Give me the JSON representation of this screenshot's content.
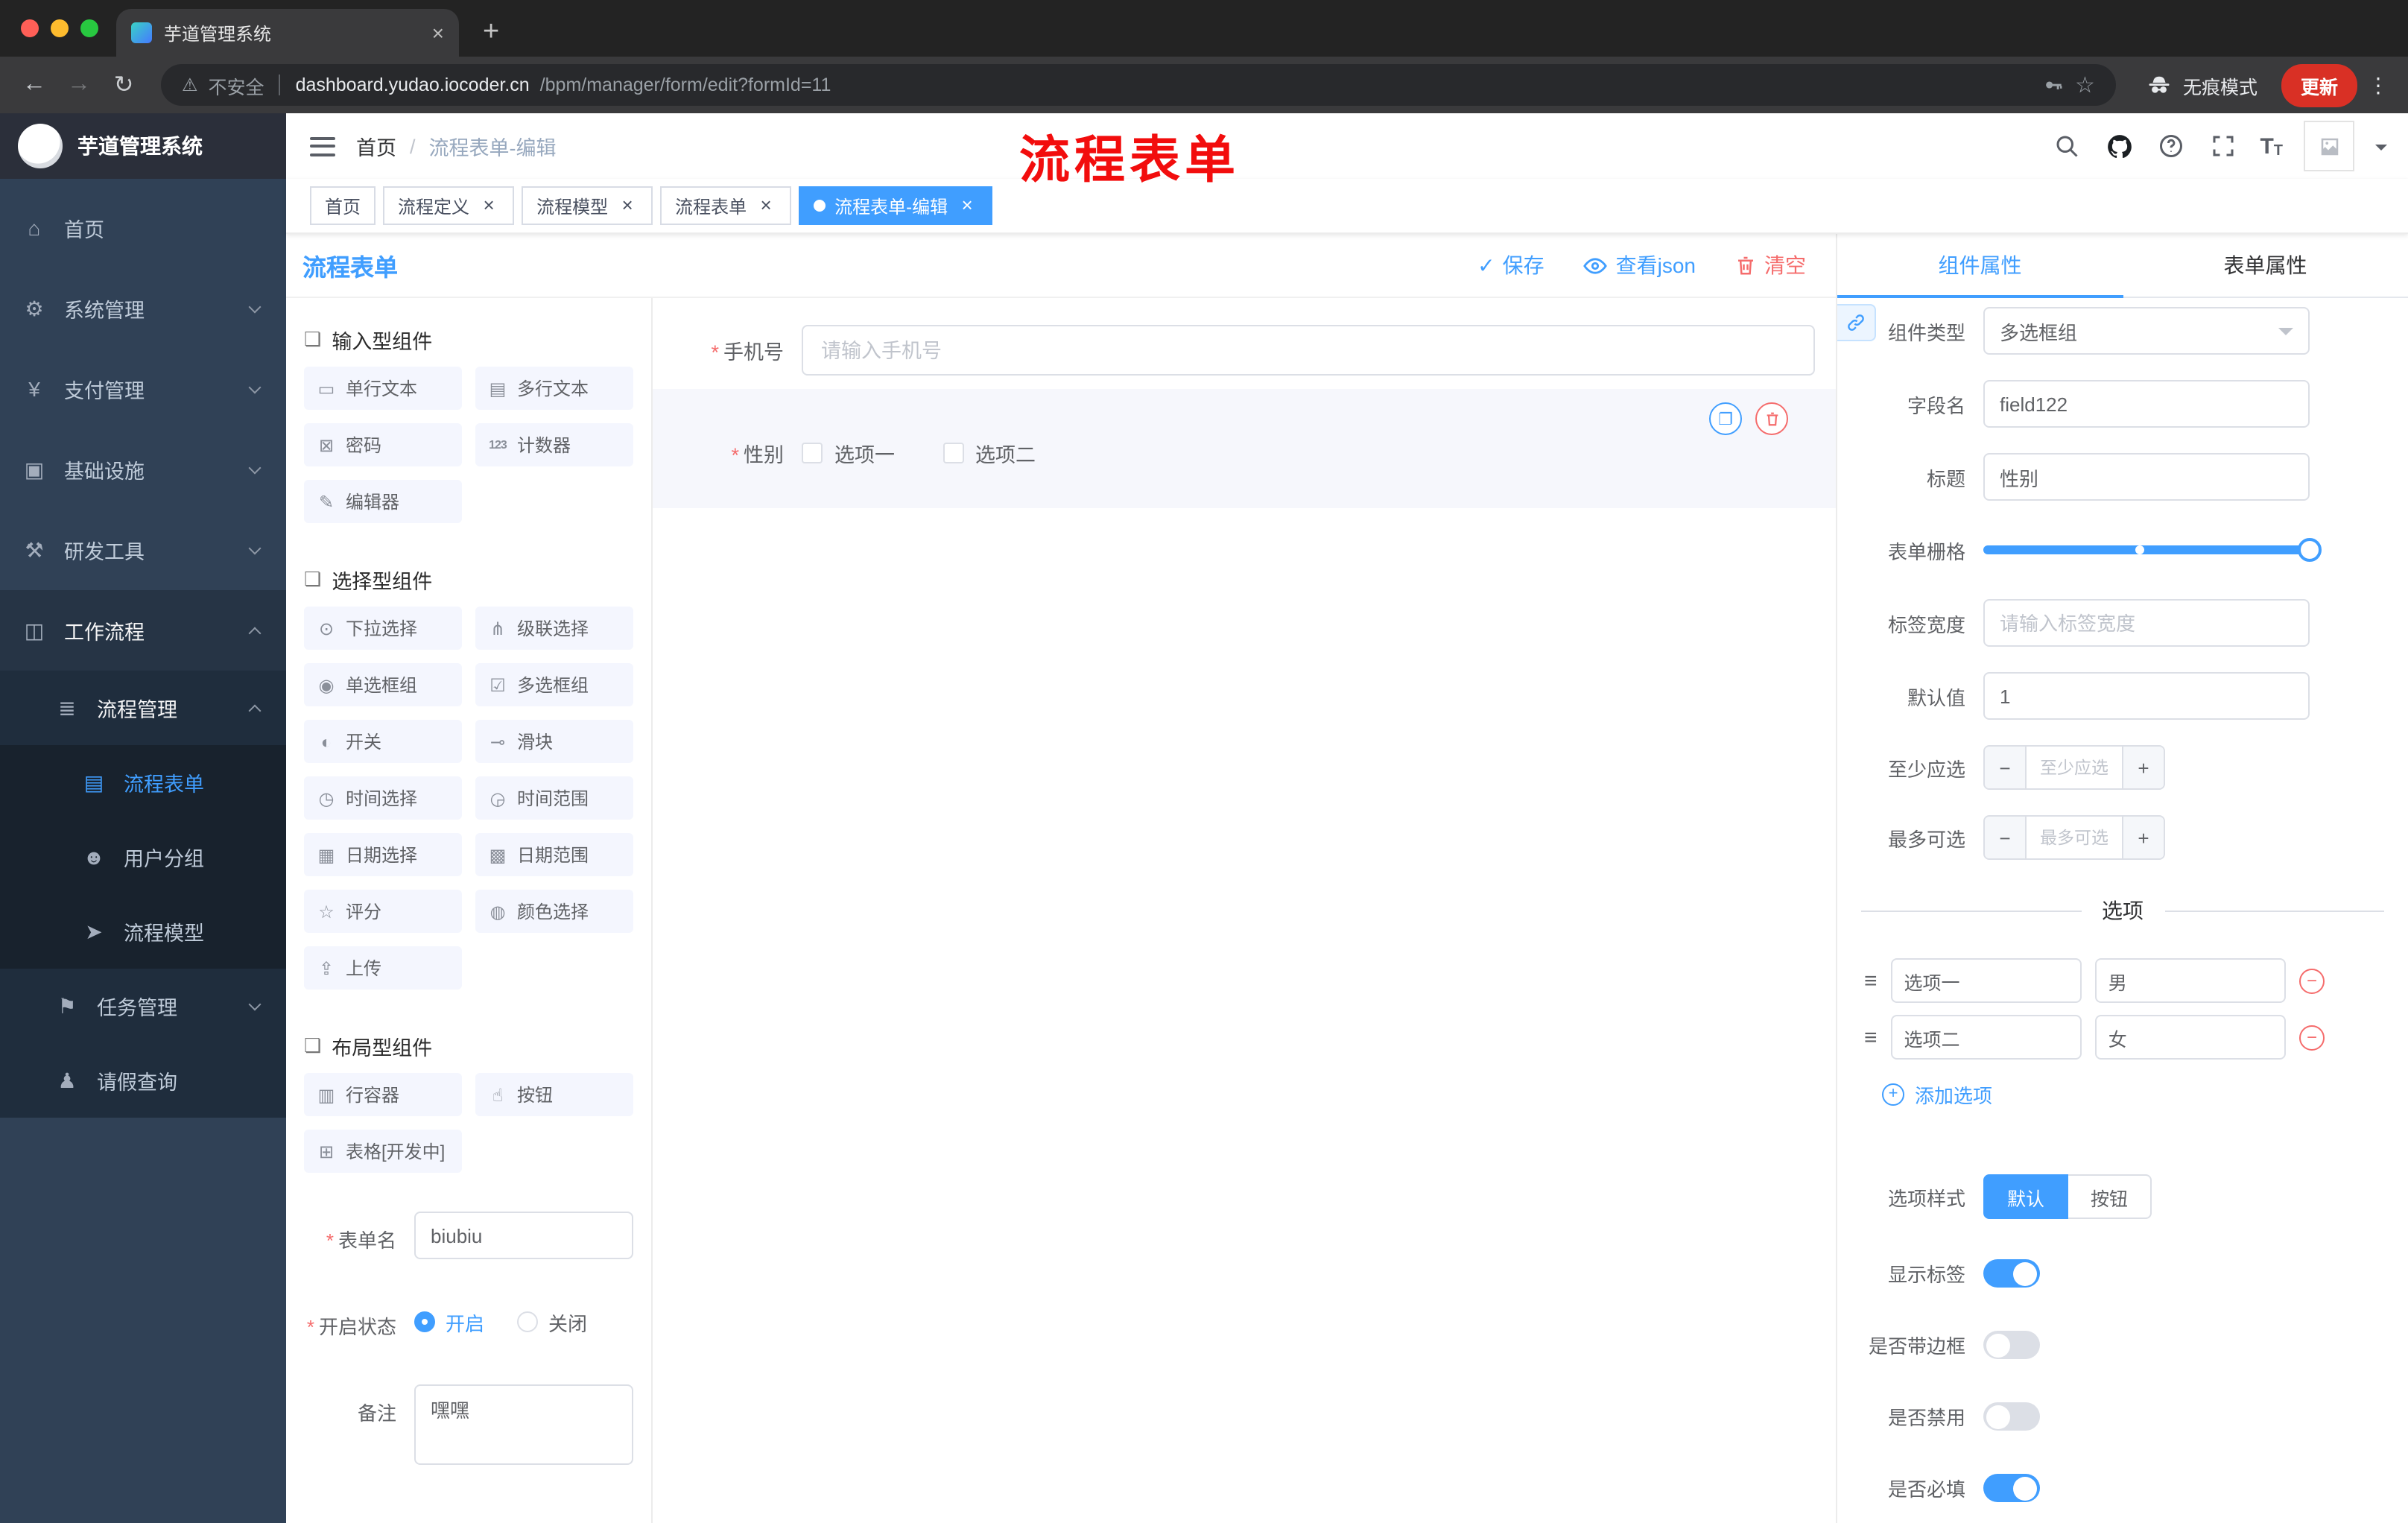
{
  "colors": {
    "accent": "#409eff",
    "danger": "#f56c6c",
    "annotation": "#f20d0d",
    "sidebar_bg": "#304156",
    "active_tag": "#409eff"
  },
  "browser": {
    "tab_title": "芋道管理系统",
    "security": "不安全",
    "domain": "dashboard.yudao.iocoder.cn",
    "path": "/bpm/manager/form/edit?formId=11",
    "incognito": "无痕模式",
    "update": "更新"
  },
  "sidebar": {
    "title": "芋道管理系统",
    "menu": [
      {
        "key": "home",
        "label": "首页",
        "glyph": "⌂",
        "level": 1
      },
      {
        "key": "system",
        "label": "系统管理",
        "glyph": "⚙",
        "level": 1,
        "chevron": "down"
      },
      {
        "key": "payment",
        "label": "支付管理",
        "glyph": "¥",
        "level": 1,
        "chevron": "down"
      },
      {
        "key": "infra",
        "label": "基础设施",
        "glyph": "▣",
        "level": 1,
        "chevron": "down"
      },
      {
        "key": "devtools",
        "label": "研发工具",
        "glyph": "⚒",
        "level": 1,
        "chevron": "down"
      },
      {
        "key": "workflow",
        "label": "工作流程",
        "glyph": "◫",
        "level": 1,
        "chevron": "up",
        "open": true
      },
      {
        "key": "process-mgmt",
        "label": "流程管理",
        "glyph": "≣",
        "level": 2,
        "chevron": "up",
        "open": true
      },
      {
        "key": "process-form",
        "label": "流程表单",
        "glyph": "▤",
        "level": 3,
        "active": true
      },
      {
        "key": "user-group",
        "label": "用户分组",
        "glyph": "☻",
        "level": 3
      },
      {
        "key": "process-model",
        "label": "流程模型",
        "glyph": "➤",
        "level": 3
      },
      {
        "key": "task-mgmt",
        "label": "任务管理",
        "glyph": "⚑",
        "level": 2,
        "chevron": "down"
      },
      {
        "key": "leave-query",
        "label": "请假查询",
        "glyph": "♟",
        "level": 2
      }
    ]
  },
  "header": {
    "breadcrumb": [
      "首页",
      "流程表单-编辑"
    ],
    "annotation": "流程表单"
  },
  "tags": [
    {
      "key": "home",
      "label": "首页",
      "closable": false,
      "active": false
    },
    {
      "key": "process-definition",
      "label": "流程定义",
      "closable": true,
      "active": false
    },
    {
      "key": "process-model",
      "label": "流程模型",
      "closable": true,
      "active": false
    },
    {
      "key": "process-form",
      "label": "流程表单",
      "closable": true,
      "active": false
    },
    {
      "key": "process-form-edit",
      "label": "流程表单-编辑",
      "closable": true,
      "active": true
    }
  ],
  "designer": {
    "title": "流程表单",
    "actions": {
      "save": "保存",
      "view_json": "查看json",
      "clear": "清空"
    }
  },
  "palette": {
    "groups": [
      {
        "title": "输入型组件",
        "items": [
          {
            "key": "single-text",
            "label": "单行文本",
            "glyph": "▭"
          },
          {
            "key": "multi-text",
            "label": "多行文本",
            "glyph": "▤"
          },
          {
            "key": "password",
            "label": "密码",
            "glyph": "⊠"
          },
          {
            "key": "counter",
            "label": "计数器",
            "glyph": "123"
          },
          {
            "key": "editor",
            "label": "编辑器",
            "glyph": "✎"
          }
        ]
      },
      {
        "title": "选择型组件",
        "items": [
          {
            "key": "select",
            "label": "下拉选择",
            "glyph": "⊙"
          },
          {
            "key": "cascader",
            "label": "级联选择",
            "glyph": "⋔"
          },
          {
            "key": "radio-group",
            "label": "单选框组",
            "glyph": "◉"
          },
          {
            "key": "checkbox-group",
            "label": "多选框组",
            "glyph": "☑"
          },
          {
            "key": "switch",
            "label": "开关",
            "glyph": "◐"
          },
          {
            "key": "slider",
            "label": "滑块",
            "glyph": "⊸"
          },
          {
            "key": "time-picker",
            "label": "时间选择",
            "glyph": "◷"
          },
          {
            "key": "time-range",
            "label": "时间范围",
            "glyph": "◶"
          },
          {
            "key": "date-picker",
            "label": "日期选择",
            "glyph": "▦"
          },
          {
            "key": "date-range",
            "label": "日期范围",
            "glyph": "▩"
          },
          {
            "key": "rate",
            "label": "评分",
            "glyph": "☆"
          },
          {
            "key": "color-picker",
            "label": "颜色选择",
            "glyph": "◍"
          },
          {
            "key": "upload",
            "label": "上传",
            "glyph": "⇪"
          }
        ]
      },
      {
        "title": "布局型组件",
        "items": [
          {
            "key": "row-container",
            "label": "行容器",
            "glyph": "▥"
          },
          {
            "key": "button",
            "label": "按钮",
            "glyph": "☝"
          },
          {
            "key": "table",
            "label": "表格[开发中]",
            "glyph": "⊞"
          }
        ]
      }
    ]
  },
  "form_meta": {
    "name_label": "表单名",
    "name_value": "biubiu",
    "status_label": "开启状态",
    "status_options": [
      {
        "label": "开启",
        "checked": true
      },
      {
        "label": "关闭",
        "checked": false
      }
    ],
    "remark_label": "备注",
    "remark_value": "嘿嘿"
  },
  "canvas": {
    "phone": {
      "label": "手机号",
      "placeholder": "请输入手机号",
      "required": true
    },
    "gender": {
      "label": "性别",
      "required": true,
      "options": [
        "选项一",
        "选项二"
      ]
    }
  },
  "props": {
    "tabs": [
      {
        "key": "component",
        "label": "组件属性",
        "active": true
      },
      {
        "key": "form",
        "label": "表单属性",
        "active": false
      }
    ],
    "component_type": {
      "label": "组件类型",
      "value": "多选框组"
    },
    "field_name": {
      "label": "字段名",
      "value": "field122"
    },
    "title": {
      "label": "标题",
      "value": "性别"
    },
    "grid": {
      "label": "表单栅格",
      "handle_percent": 100,
      "mark_percent": 48
    },
    "label_width": {
      "label": "标签宽度",
      "placeholder": "请输入标签宽度"
    },
    "default_value": {
      "label": "默认值",
      "value": "1"
    },
    "min_select": {
      "label": "至少应选",
      "placeholder": "至少应选"
    },
    "max_select": {
      "label": "最多可选",
      "placeholder": "最多可选"
    },
    "options_title": "选项",
    "options": [
      {
        "label": "选项一",
        "value": "男"
      },
      {
        "label": "选项二",
        "value": "女"
      }
    ],
    "add_option": "添加选项",
    "option_style": {
      "label": "选项样式",
      "choices": [
        {
          "label": "默认",
          "active": true
        },
        {
          "label": "按钮",
          "active": false
        }
      ]
    },
    "switches": [
      {
        "key": "show-label",
        "label": "显示标签",
        "on": true
      },
      {
        "key": "bordered",
        "label": "是否带边框",
        "on": false
      },
      {
        "key": "disabled",
        "label": "是否禁用",
        "on": false
      },
      {
        "key": "required",
        "label": "是否必填",
        "on": true
      }
    ]
  }
}
